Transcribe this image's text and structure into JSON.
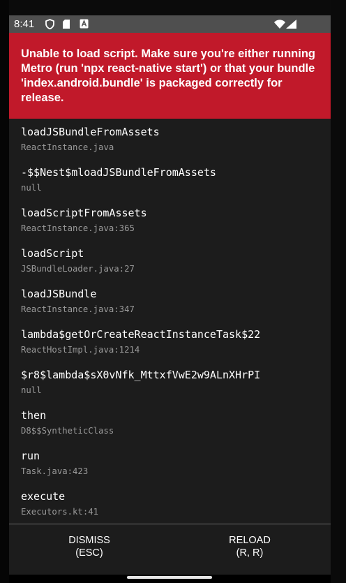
{
  "status_bar": {
    "time": "8:41",
    "icons": [
      "privacy-shield-icon",
      "sd-card-icon",
      "notification-app-icon",
      "wifi-icon",
      "cellular-signal-icon"
    ]
  },
  "error": {
    "message": "Unable to load script. Make sure you're either running Metro (run 'npx react-native start') or that your bundle 'index.android.bundle' is packaged correctly for release.",
    "background_color": "#c1192a"
  },
  "stack_frames": [
    {
      "method": "loadJSBundleFromAssets",
      "file": "ReactInstance.java"
    },
    {
      "method": "-$$Nest$mloadJSBundleFromAssets",
      "file": "null"
    },
    {
      "method": "loadScriptFromAssets",
      "file": "ReactInstance.java:365"
    },
    {
      "method": "loadScript",
      "file": "JSBundleLoader.java:27"
    },
    {
      "method": "loadJSBundle",
      "file": "ReactInstance.java:347"
    },
    {
      "method": "lambda$getOrCreateReactInstanceTask$22",
      "file": "ReactHostImpl.java:1214"
    },
    {
      "method": "$r8$lambda$sX0vNfk_MttxfVwE2w9ALnXHrPI",
      "file": "null"
    },
    {
      "method": "then",
      "file": "D8$$SyntheticClass"
    },
    {
      "method": "run",
      "file": "Task.java:423"
    },
    {
      "method": "execute",
      "file": "Executors.kt:41"
    }
  ],
  "footer": {
    "dismiss_label": "DISMISS",
    "dismiss_shortcut": "(ESC)",
    "reload_label": "RELOAD",
    "reload_shortcut": "(R, R)"
  },
  "colors": {
    "screen_background": "#1c1c1c",
    "status_bar_background": "#4f4f4f",
    "file_text": "#9a9a9a"
  }
}
